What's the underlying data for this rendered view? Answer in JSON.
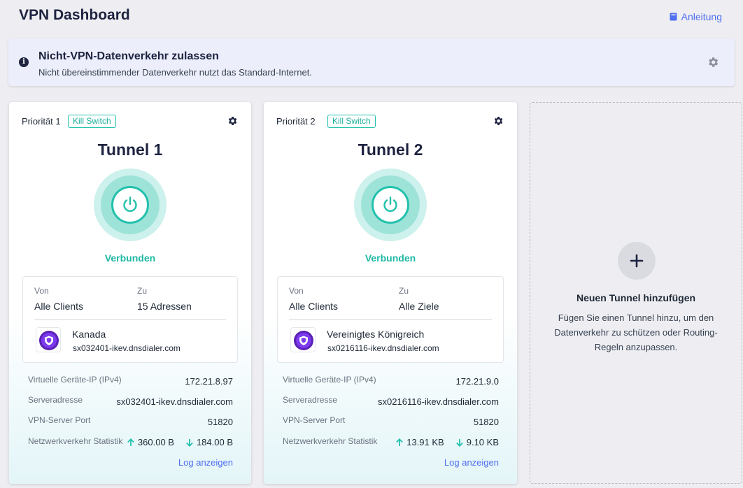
{
  "header": {
    "title": "VPN Dashboard",
    "guide_label": "Anleitung"
  },
  "banner": {
    "title": "Nicht-VPN-Datenverkehr zulassen",
    "description": "Nicht übereinstimmender Datenverkehr nutzt das Standard-Internet."
  },
  "labels": {
    "from": "Von",
    "to": "Zu",
    "virtual_ip": "Virtuelle Geräte-IP (IPv4)",
    "server_address": "Serveradresse",
    "server_port": "VPN-Server Port",
    "traffic_stats": "Netzwerkverkehr Statistik",
    "show_log": "Log anzeigen",
    "kill_switch": "Kill Switch"
  },
  "tunnels": [
    {
      "priority": "Priorität 1",
      "name": "Tunnel 1",
      "status": "Verbunden",
      "from": "Alle Clients",
      "to": "15 Adressen",
      "country": "Kanada",
      "host": "sx032401-ikev.dnsdialer.com",
      "virtual_ip": "172.21.8.97",
      "server_address": "sx032401-ikev.dnsdialer.com",
      "server_port": "51820",
      "upload": "360.00 B",
      "download": "184.00 B"
    },
    {
      "priority": "Priorität 2",
      "name": "Tunnel 2",
      "status": "Verbunden",
      "from": "Alle Clients",
      "to": "Alle Ziele",
      "country": "Vereinigtes Königreich",
      "host": "sx0216116-ikev.dnsdialer.com",
      "virtual_ip": "172.21.9.0",
      "server_address": "sx0216116-ikev.dnsdialer.com",
      "server_port": "51820",
      "upload": "13.91 KB",
      "download": "9.10 KB"
    }
  ],
  "add_tunnel": {
    "title": "Neuen Tunnel hinzufügen",
    "description": "Fügen Sie einen Tunnel hinzu, um den Datenverkehr zu schützen oder Routing-Regeln anzupassen."
  },
  "colors": {
    "accent": "#22c1ac",
    "link": "#4f6ef0",
    "heading": "#1e2340"
  },
  "icons": {
    "guide": "book-icon",
    "info": "info-icon",
    "settings": "gear-icon",
    "power": "power-icon",
    "server": "shield-icon",
    "upload": "arrow-up-icon",
    "download": "arrow-down-icon",
    "add": "plus-icon"
  }
}
